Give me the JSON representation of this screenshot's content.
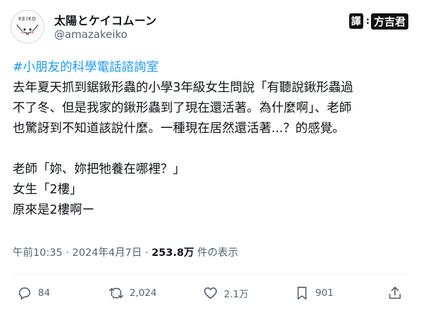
{
  "account": {
    "display_name": "太陽とケイコムーン",
    "handle": "@amazakeiko",
    "avatar_text": "KEIKO"
  },
  "badge": {
    "chip": "譯",
    "colon": ":",
    "text": "方吉君"
  },
  "post": {
    "hashtag": "#小朋友的科學電話諮詢室",
    "lines": [
      "去年夏天抓到鋸鍬形蟲的小學3年級女生問說「有聽說鍬形蟲過",
      "不了冬、但是我家的鍬形蟲到了現在還活著。為什麼啊」、老師",
      "也驚訝到不知道該說什麼。一種現在居然還活著...？的感覺。",
      "",
      "老師「妳、妳把牠養在哪裡？」",
      "女生「2樓」",
      "原來是2樓啊ー"
    ]
  },
  "meta": {
    "time": "午前10:35",
    "sep1": " · ",
    "date": "2024年4月7日",
    "sep2": " · ",
    "views_value": "253.8万",
    "views_label": " 件の表示"
  },
  "actions": {
    "replies": "84",
    "reposts": "2,024",
    "likes": "2.1万",
    "bookmarks": "901"
  },
  "colors": {
    "hashtag": "#1d9bf0",
    "secondary_text": "#536471",
    "primary_text": "#0f1419"
  },
  "icons": [
    "reply-icon",
    "retweet-icon",
    "like-icon",
    "bookmark-icon",
    "share-icon"
  ]
}
